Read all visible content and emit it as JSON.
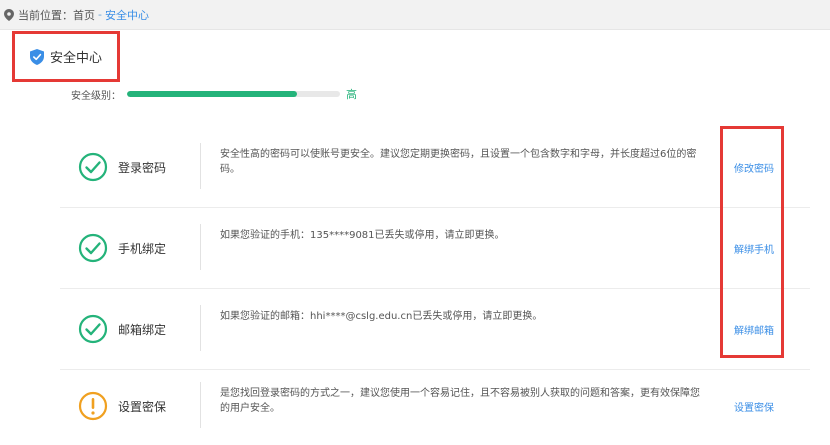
{
  "breadcrumb": {
    "prefix": "当前位置：",
    "home": "首页",
    "separator": "-",
    "current": "安全中心"
  },
  "page_title": "安全中心",
  "security_level": {
    "label": "安全级别：",
    "value_text": "高",
    "fill_fraction": 0.8,
    "color": "#24b37a"
  },
  "items": [
    {
      "label": "登录密码",
      "status": "ok",
      "description": "安全性高的密码可以使账号更安全。建议您定期更换密码，且设置一个包含数字和字母，并长度超过6位的密码。",
      "action": "修改密码"
    },
    {
      "label": "手机绑定",
      "status": "ok",
      "description": "如果您验证的手机：135****9081已丢失或停用，请立即更换。",
      "action": "解绑手机"
    },
    {
      "label": "邮箱绑定",
      "status": "ok",
      "description": "如果您验证的邮箱：hhi****@cslg.edu.cn已丢失或停用，请立即更换。",
      "action": "解绑邮箱"
    },
    {
      "label": "设置密保",
      "status": "warning",
      "description": "是您找回登录密码的方式之一，建议您使用一个容易记住，且不容易被别人获取的问题和答案，更有效保障您的用户安全。",
      "action": "设置密保"
    }
  ],
  "colors": {
    "ok": "#24b37a",
    "warning": "#f0a020",
    "link": "#3a8ee6",
    "highlight": "#e53935"
  }
}
